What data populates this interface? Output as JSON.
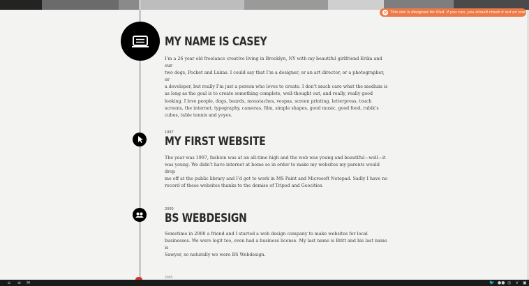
{
  "notice": {
    "close_icon": "x-circle-icon",
    "text": "This site is designed for iPad. If you can, you should check it out on one."
  },
  "sections": [
    {
      "year": "",
      "heading": "MY NAME IS CASEY",
      "icon": "laptop-icon",
      "lines": [
        "I’m a 26 year old freelance creative living in Brooklyn, NY with my beautiful girlfriend Erika and our",
        "two dogs, Pocket and Lukas. I could say that I’m a designer, or an art director, or a photographer, or",
        "a developer, but really I’m just a person who loves to create. I don’t much care what the medium is",
        "as long as the goal is to create something complete, well-thought out, and really, really good",
        "looking. I love people, dogs, beards, moustaches, vespas, screen printing, letterpress, touch",
        "screens, the internet, typography, cameras, film, simple shapes, good music, good food, rubik’s",
        "cubes, table tennis and yoyos."
      ]
    },
    {
      "year": "1997",
      "heading": "MY FIRST WEBSITE",
      "icon": "cursor-icon",
      "lines": [
        "The year was 1997, fashion was at an all-time high and the web was young and beautiful—well—it",
        "was young. We didn’t have internet at home so in order to make my websites my parents would drop",
        "me off at the public library and I’d get to work in MS Paint and Microsoft Notepad. Sadly I have no",
        "record of these websites thanks to the demise of Tripod and Geocities."
      ]
    },
    {
      "year": "2000",
      "heading": "BS WEBDESIGN",
      "icon": "people-icon",
      "lines": [
        "Sometime in 2000 a friend and I started a web design company to make websites for local",
        "businesses. We were legit too, even had a business license. My last name is Britt and his last name is",
        "Sawyer, so naturally we were BS Webdesign."
      ]
    }
  ],
  "next_year_partial": "2005",
  "bottom_bar": {
    "left_icons": [
      "home-icon",
      "list-icon",
      "mail-icon"
    ],
    "right_icons": [
      "twitter-icon",
      "flickr-icon",
      "dribbble-icon",
      "vimeo-icon",
      "linkedin-icon"
    ]
  }
}
